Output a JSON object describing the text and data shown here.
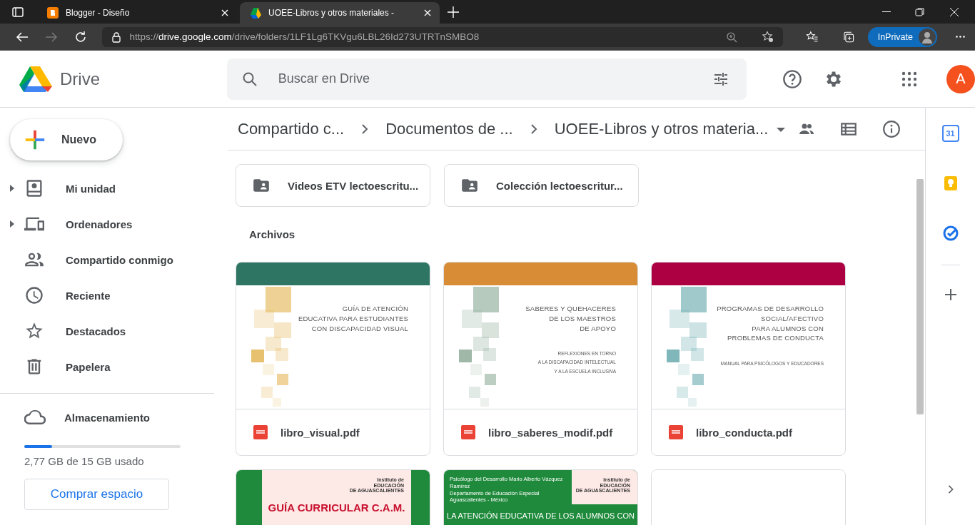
{
  "browser": {
    "tabs": [
      {
        "title": "Blogger - Diseño",
        "kind": "blogger",
        "selected": false
      },
      {
        "title": "UOEE-Libros y otros materiales -",
        "kind": "drive",
        "selected": true
      }
    ],
    "url_scheme": "https://",
    "url_host": "drive.google.com",
    "url_path": "/drive/folders/1LF1Lg6TKVgu6LBL26Id273UTRTnSMBO8",
    "profile_label": "InPrivate"
  },
  "header": {
    "app_name": "Drive",
    "search": {
      "placeholder": "Buscar en Drive"
    },
    "avatar": "A"
  },
  "sidebar": {
    "new_button": "Nuevo",
    "items": [
      {
        "label": "Mi unidad",
        "kind": "drive",
        "expandable": true,
        "selected": false
      },
      {
        "label": "Ordenadores",
        "kind": "computers",
        "expandable": true,
        "selected": false
      },
      {
        "label": "Compartido conmigo",
        "kind": "shared",
        "expandable": false,
        "selected": false
      },
      {
        "label": "Reciente",
        "kind": "clock",
        "expandable": false,
        "selected": false
      },
      {
        "label": "Destacados",
        "kind": "star",
        "expandable": false,
        "selected": false
      },
      {
        "label": "Papelera",
        "kind": "trash",
        "expandable": false,
        "selected": false
      }
    ],
    "storage": {
      "label": "Almacenamiento",
      "level": 0.18,
      "usage": "2,77 GB de 15 GB usado",
      "buy_button": "Comprar espacio"
    }
  },
  "breadcrumbs": [
    "Compartido c...",
    "Documentos de ...",
    "UOEE-Libros y otros materia..."
  ],
  "folders": [
    {
      "name": "Videos ETV lectoescritu..."
    },
    {
      "name": "Colección lectoescritur..."
    }
  ],
  "files_heading": "Archivos",
  "files": [
    {
      "name": "libro_visual.pdf",
      "kind": "squares",
      "color": "#2f7563",
      "squares": {
        "color": "#e8c170"
      },
      "cover_title": [
        "GUÍA DE ATENCIÓN",
        "EDUCATIVA PARA ESTUDIANTES",
        "CON DISCAPACIDAD VISUAL"
      ]
    },
    {
      "name": "libro_saberes_modif.pdf",
      "kind": "squares",
      "color": "#d88c36",
      "squares": {
        "color": "#9fb8a8"
      },
      "cover_title": [
        "SABERES Y QUEHACERES",
        "DE LOS MAESTROS",
        "DE APOYO"
      ],
      "cover_subtitle": [
        "REFLEXIONES EN TORNO",
        "A LA DISCAPACIDAD INTELECTUAL",
        "Y A LA ESCUELA INCLUSIVA"
      ]
    },
    {
      "name": "libro_conducta.pdf",
      "kind": "squares",
      "color": "#ad0042",
      "squares": {
        "color": "#7fb7ba"
      },
      "cover_title": [
        "PROGRAMAS DE DESARROLLO",
        "SOCIAL/AFECTIVO",
        "PARA ALUMNOS CON",
        "PROBLEMAS DE CONDUCTA"
      ],
      "cover_subtitle": [
        "MANUAL PARA PSICÓLOGOS Y EDUCADORES"
      ]
    },
    {
      "kind": "institute",
      "color": "#1f8a3c",
      "institute": [
        "Instituto de",
        "EDUCACIÓN",
        "DE AGUASCALIENTES"
      ],
      "cover_title": [
        "GUÍA CURRICULAR C.A.M."
      ]
    },
    {
      "kind": "banner",
      "color": "#1f8a3c",
      "credits": [
        "Psicólogo del Desarrollo  Mario Alberto Vázquez Ramírez",
        "Departamento de Educación Especial",
        "Aguascalientes - México"
      ],
      "institute": [
        "Instituto de",
        "EDUCACIÓN",
        "DE AGUASCALIENTES"
      ],
      "cover_title": [
        "LA ATENCIÓN EDUCATIVA DE LOS ALUMNOS CON"
      ]
    },
    {
      "kind": "blank"
    }
  ],
  "side_panel": {
    "calendar_day": "31"
  }
}
